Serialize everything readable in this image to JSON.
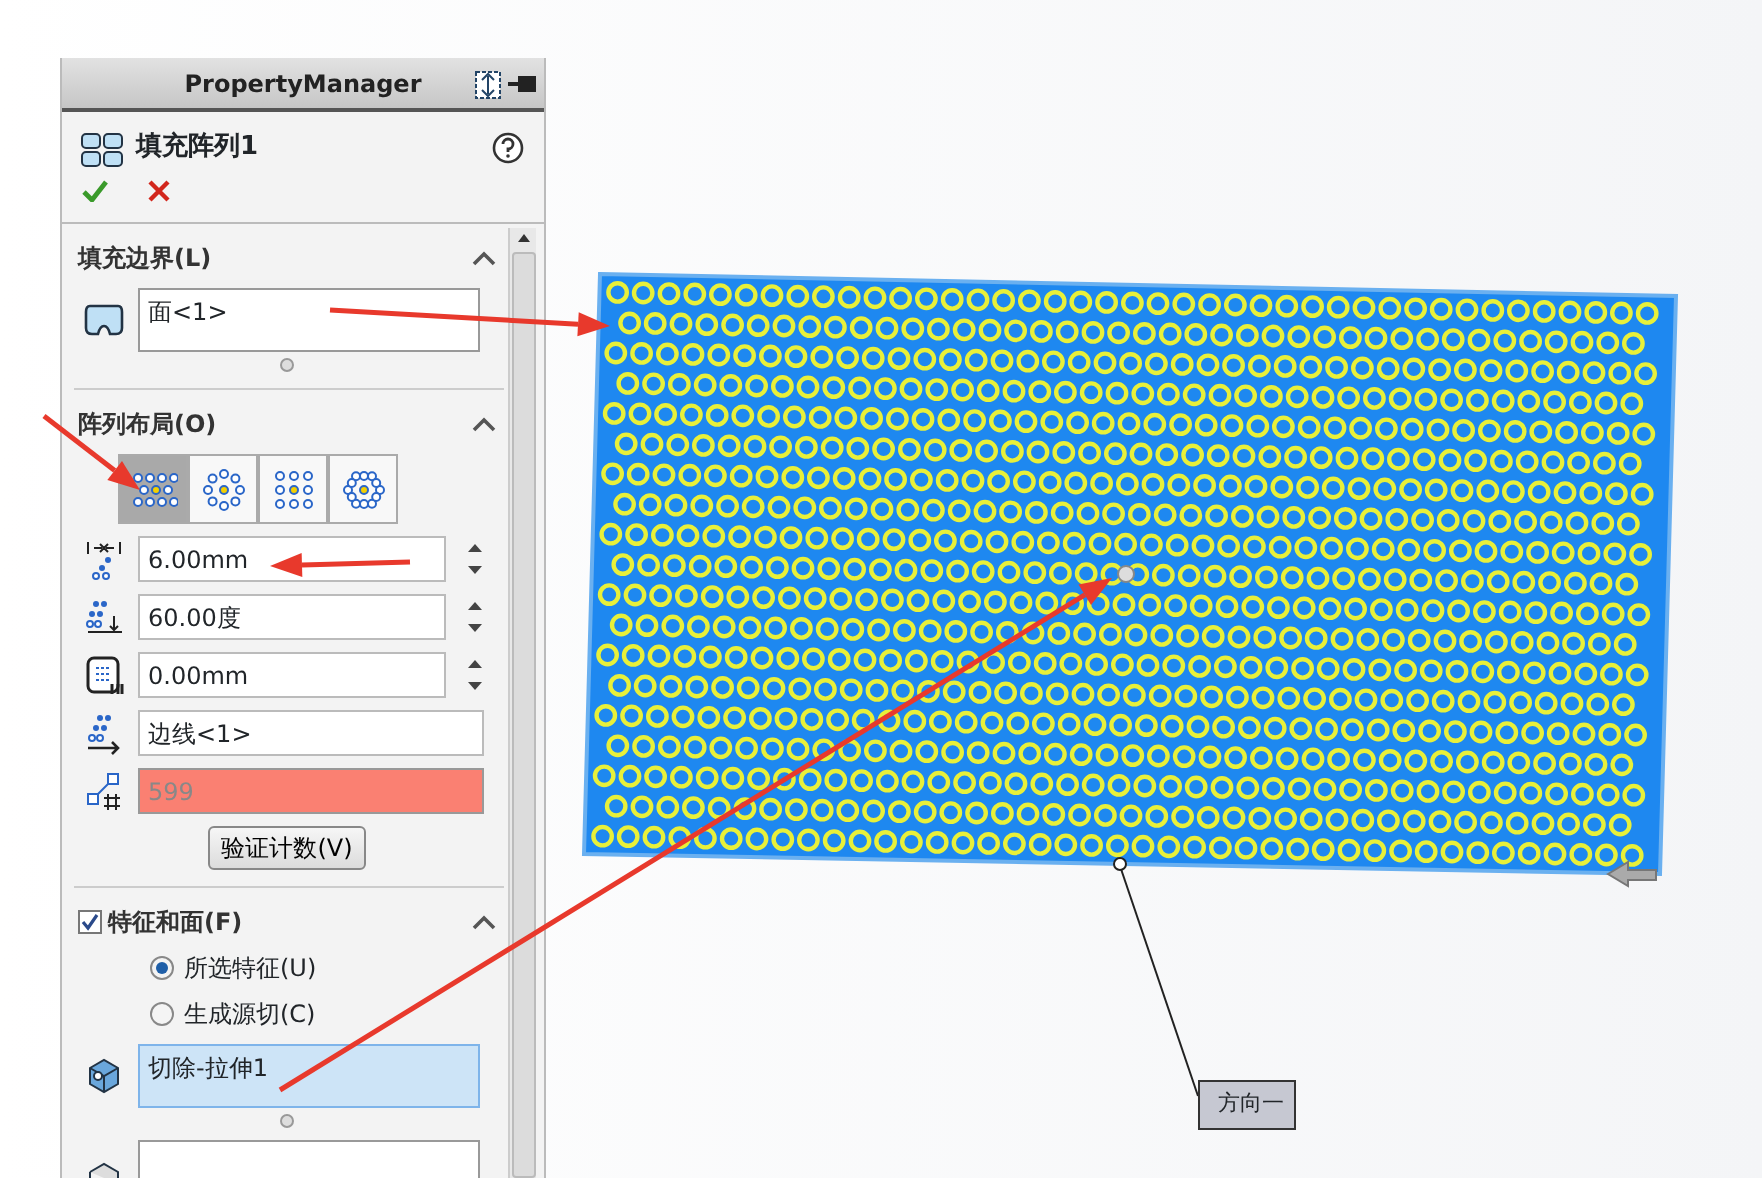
{
  "panel": {
    "title": "PropertyManager"
  },
  "feature": {
    "name": "填充阵列1"
  },
  "fill_boundary": {
    "heading": "填充边界(L)",
    "expanded": true,
    "selection": "面<1>"
  },
  "layout": {
    "heading": "阵列布局(O)",
    "expanded": true,
    "layout_buttons": [
      {
        "kind": "perforation",
        "selected": true
      },
      {
        "kind": "circular",
        "selected": false
      },
      {
        "kind": "square",
        "selected": false
      },
      {
        "kind": "polygon",
        "selected": false
      }
    ],
    "fields": [
      {
        "kind": "spin",
        "value": "6.00mm"
      },
      {
        "kind": "spin",
        "value": "60.00度"
      },
      {
        "kind": "spin",
        "value": "0.00mm"
      },
      {
        "kind": "text",
        "value": "边线<1>"
      },
      {
        "kind": "count",
        "value": "599",
        "disabled": true
      }
    ],
    "button": "验证计数(V)"
  },
  "features": {
    "heading": "特征和面(F)",
    "checked": true,
    "expanded": true,
    "options": [
      {
        "label": "所选特征(U)",
        "selected": true
      },
      {
        "label": "生成源切(C)",
        "selected": false
      }
    ],
    "selection": "切除-拉伸1"
  },
  "callout": {
    "label": "方向一"
  }
}
